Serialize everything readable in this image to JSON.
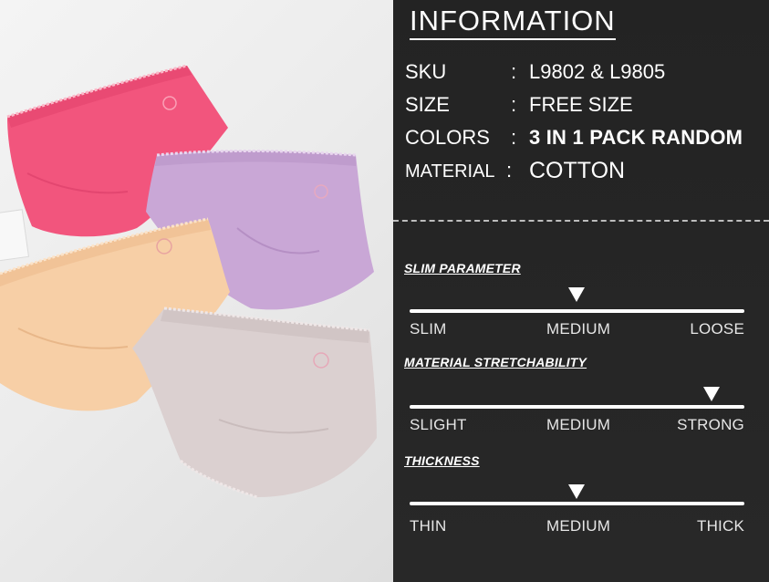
{
  "info": {
    "title": "INFORMATION",
    "specs": {
      "sku": {
        "key": "SKU",
        "colon": ":",
        "value": "L9802 & L9805"
      },
      "size": {
        "key": "SIZE",
        "colon": ":",
        "value": "FREE SIZE"
      },
      "colors": {
        "key": "COLORS",
        "colon": ":",
        "value": "3 IN 1 PACK RANDOM"
      },
      "material": {
        "key": "MATERIAL",
        "colon": ":",
        "value": "COTTON"
      }
    }
  },
  "parameters": {
    "slim": {
      "title": "SLIM PARAMETER",
      "labels": [
        "SLIM",
        "MEDIUM",
        "LOOSE"
      ],
      "selected": "MEDIUM"
    },
    "stretch": {
      "title": "MATERIAL STRETCHABILITY",
      "labels": [
        "SLIGHT",
        "MEDIUM",
        "STRONG"
      ],
      "selected": "STRONG"
    },
    "thickness": {
      "title": "THICKNESS",
      "labels": [
        "THIN",
        "MEDIUM",
        "THICK"
      ],
      "selected": "MEDIUM"
    }
  },
  "photo": {
    "subject": "four folded briefs",
    "colors": {
      "pink": "#f2557d",
      "lilac": "#c9a7d6",
      "peach": "#f7cfa6",
      "taupe": "#d9cfcf"
    }
  },
  "colors": {
    "panel_bg": "#262626",
    "text": "#ffffff"
  }
}
